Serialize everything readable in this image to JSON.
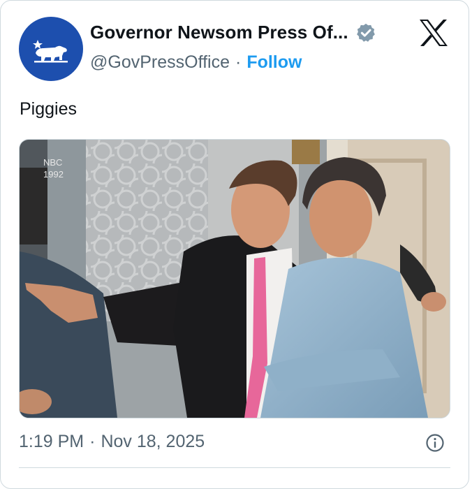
{
  "author": {
    "display_name": "Governor Newsom Press Of...",
    "handle": "@GovPressOffice",
    "separator": "·",
    "follow_label": "Follow",
    "avatar_icon": "california-bear-icon",
    "verified_icon": "verified-badge-icon",
    "avatar_color": "#1d4fae"
  },
  "brand": {
    "icon": "x-logo-icon"
  },
  "post": {
    "text": "Piggies"
  },
  "media": {
    "watermark_line1": "NBC",
    "watermark_line2": "1992"
  },
  "meta": {
    "time": "1:19 PM",
    "separator": "·",
    "date": "Nov 18, 2025",
    "info_icon": "info-icon"
  },
  "colors": {
    "link": "#1d9bf0",
    "muted": "#536471",
    "border": "#cfd9de"
  }
}
